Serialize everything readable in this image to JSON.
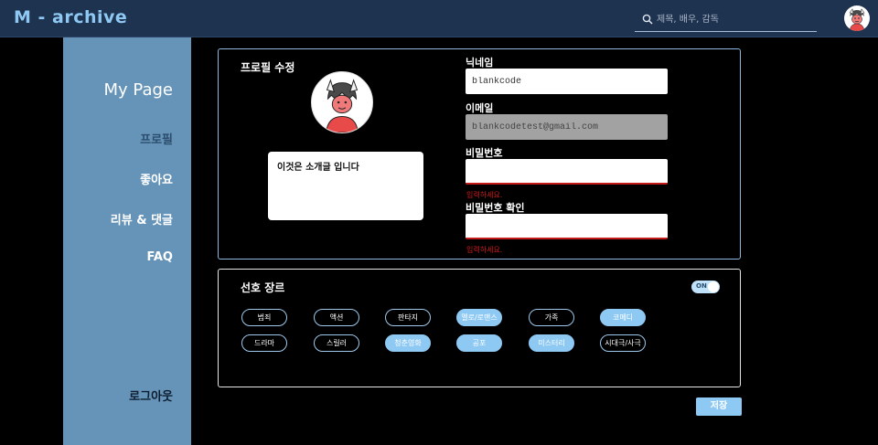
{
  "header": {
    "logo": "M - archive",
    "search_placeholder": "제목, 배우, 감독",
    "search_icon": "search-icon",
    "avatar_icon": "demon-mask-avatar-icon"
  },
  "sidebar": {
    "title": "My Page",
    "items": [
      {
        "label": "프로필",
        "active": false
      },
      {
        "label": "좋아요",
        "active": true
      },
      {
        "label": "리뷰 & 댓글",
        "active": true
      },
      {
        "label": "FAQ",
        "active": true
      }
    ],
    "logout": "로그아웃"
  },
  "profile": {
    "title": "프로필 수정",
    "avatar_icon": "demon-mask-avatar-icon",
    "bio": "이것은 소개글 입니다",
    "nickname_label": "닉네임",
    "nickname_value": "blankcode",
    "email_label": "이메일",
    "email_value": "blankcodetest@gmail.com",
    "password_label": "비밀번호",
    "password_error": "입력하세요.",
    "password_confirm_label": "비밀번호 확인",
    "password_confirm_error": "입력하세요."
  },
  "genre": {
    "title": "선호 장르",
    "toggle_label": "ON",
    "toggle_on": true,
    "chips": [
      {
        "label": "범죄",
        "selected": false
      },
      {
        "label": "액션",
        "selected": false
      },
      {
        "label": "판타지",
        "selected": false
      },
      {
        "label": "멜로/로맨스",
        "selected": true
      },
      {
        "label": "가족",
        "selected": false
      },
      {
        "label": "코메디",
        "selected": true
      },
      {
        "label": "드라마",
        "selected": false
      },
      {
        "label": "스릴러",
        "selected": false
      },
      {
        "label": "청춘영화",
        "selected": true
      },
      {
        "label": "공포",
        "selected": true
      },
      {
        "label": "미스터리",
        "selected": true
      },
      {
        "label": "시대극/사극",
        "selected": false
      }
    ]
  },
  "save_label": "저장",
  "colors": {
    "header_bg": "#1e3350",
    "sidebar_bg": "#6694b8",
    "accent": "#8ec9f4",
    "error": "#d11b1b"
  }
}
